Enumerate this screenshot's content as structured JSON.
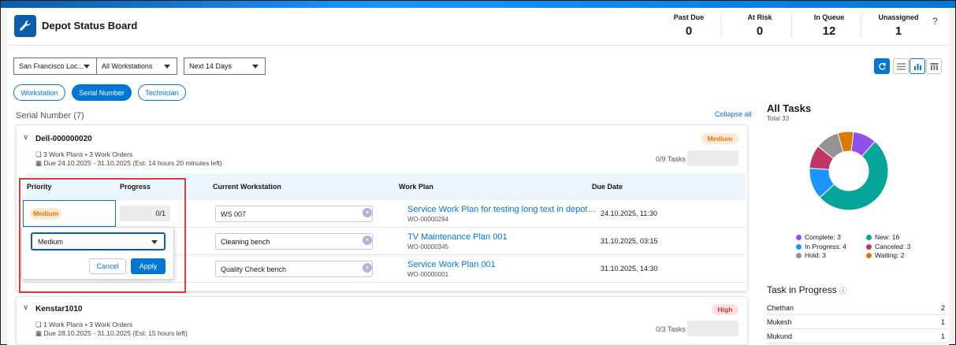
{
  "header": {
    "title": "Depot Status Board",
    "stats": [
      {
        "label": "Past Due",
        "value": "0"
      },
      {
        "label": "At Risk",
        "value": "0"
      },
      {
        "label": "In Queue",
        "value": "12"
      },
      {
        "label": "Unassigned",
        "value": "1"
      }
    ],
    "help": "?"
  },
  "filters": {
    "location": "San Francisco Loc...",
    "workstations": "All Workstations",
    "range": "Next 14 Days"
  },
  "groupby": {
    "workstation": "Workstation",
    "serial": "Serial Number",
    "technician": "Technician"
  },
  "section": {
    "title": "Serial Number (7)",
    "collapse": "Collapse all"
  },
  "table": {
    "headers": {
      "priority": "Priority",
      "progress": "Progress",
      "workstation": "Current Workstation",
      "workplan": "Work Plan",
      "due": "Due Date"
    }
  },
  "cards": [
    {
      "name": "Dell-000000020",
      "plans": "3 Work Plans • 3 Work Orders",
      "due": "Due 24.10.2025 - 31.10.2025 (Est: 14 hours 20 minutes left)",
      "priority": "Medium",
      "tasks": "0/9 Tasks",
      "rows": [
        {
          "priority": "Medium",
          "progress": "0/1",
          "workstation": "WS 007",
          "workplan": "Service Work Plan for testing long text in depot qu...",
          "wo": "WO-00000294",
          "due": "24.10.2025, 11:30"
        },
        {
          "workstation": "Cleaning bench",
          "workplan": "TV Maintenance Plan 001",
          "wo": "WO-00000345",
          "due": "31.10.2025, 03:15"
        },
        {
          "workstation": "Quality Check bench",
          "workplan": "Service Work Plan 001",
          "wo": "WO-00000001",
          "due": "31.10.2025, 14:30"
        }
      ]
    },
    {
      "name": "Kenstar1010",
      "plans": "1 Work Plans • 3 Work Orders",
      "due": "Due 28.10.2025 - 31.10.2025 (Est: 15 hours left)",
      "priority": "High",
      "tasks": "0/3 Tasks"
    }
  ],
  "popup": {
    "select_value": "Medium",
    "cancel": "Cancel",
    "apply": "Apply"
  },
  "all_tasks": {
    "title": "All Tasks",
    "total": "Total 33",
    "legend": [
      {
        "label": "Complete: 3",
        "color": "#9050e9",
        "value": 3
      },
      {
        "label": "New: 16",
        "color": "#06a59a",
        "value": 16
      },
      {
        "label": "In Progress: 4",
        "color": "#1b96ff",
        "value": 4
      },
      {
        "label": "Canceled: 3",
        "color": "#c23466",
        "value": 3
      },
      {
        "label": "Hold: 3",
        "color": "#939393",
        "value": 3
      },
      {
        "label": "Waiting: 2",
        "color": "#dd7a01",
        "value": 2
      }
    ]
  },
  "tip": {
    "title": "Task in Progress",
    "rows": [
      {
        "name": "Chethan",
        "count": "2"
      },
      {
        "name": "Mukesh",
        "count": "1"
      },
      {
        "name": "Mukund",
        "count": "1"
      }
    ]
  }
}
